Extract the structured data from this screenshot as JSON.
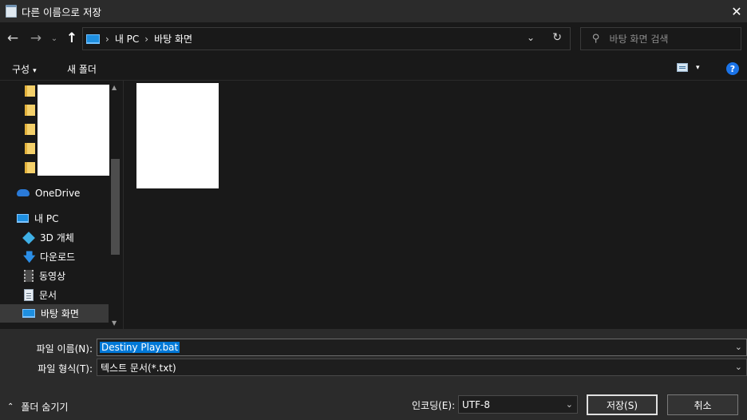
{
  "window": {
    "title": "다른 이름으로 저장",
    "close_glyph": "✕",
    "app_icon": "notepad-icon"
  },
  "nav": {
    "back_glyph": "←",
    "forward_glyph": "→",
    "recent_glyph": "⌄",
    "up_glyph": "↑",
    "breadcrumbs": [
      "내 PC",
      "바탕 화면"
    ],
    "crumb_sep": "›",
    "dropdown_glyph": "⌄",
    "refresh_glyph": "↻",
    "search_placeholder": "바탕 화면 검색",
    "search_glyph": "⚲"
  },
  "toolbar": {
    "organize_label": "구성",
    "organize_caret": "▾",
    "new_folder_label": "새 폴더",
    "view_caret": "▾",
    "help_label": "?"
  },
  "sidebar": {
    "items": [
      {
        "label": "OneDrive",
        "icon": "onedrive-icon"
      },
      {
        "label": "내 PC",
        "icon": "computer-icon"
      },
      {
        "label": "3D 개체",
        "icon": "3d-objects-icon"
      },
      {
        "label": "다운로드",
        "icon": "download-icon",
        "glyph": "🡇"
      },
      {
        "label": "동영상",
        "icon": "video-icon"
      },
      {
        "label": "문서",
        "icon": "document-icon"
      },
      {
        "label": "바탕 화면",
        "icon": "desktop-icon",
        "selected": true
      }
    ],
    "scroll_up_glyph": "▲",
    "scroll_down_glyph": "▼"
  },
  "form": {
    "filename_label": "파일 이름(N):",
    "filename_value": "Destiny Play.bat",
    "filetype_label": "파일 형식(T):",
    "filetype_value": "텍스트 문서(*.txt)",
    "encoding_label": "인코딩(E):",
    "encoding_value": "UTF-8",
    "dropdown_glyph": "⌄",
    "hide_folders_label": "폴더 숨기기",
    "hide_folders_glyph": "⌃",
    "save_label": "저장(S)",
    "cancel_label": "취소"
  },
  "colors": {
    "accent": "#0078d7",
    "background": "#191919",
    "panel": "#2b2b2b"
  }
}
